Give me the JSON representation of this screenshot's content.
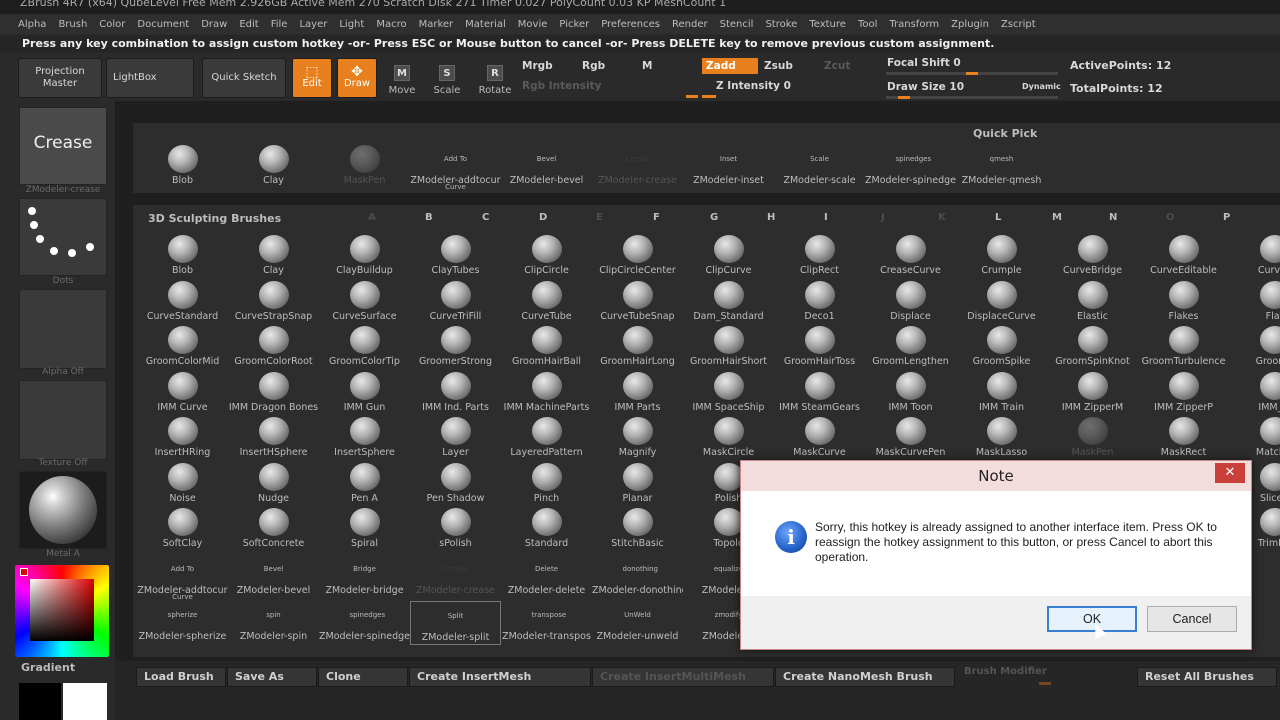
{
  "titlebar": "ZBrush 4R7 (x64)  QubeLevel   Free Mem 2.926GB  Active Mem 270  Scratch Disk 271  Timer 0.027  PolyCount 0.03 KP  MeshCount 1",
  "menu": [
    "Alpha",
    "Brush",
    "Color",
    "Document",
    "Draw",
    "Edit",
    "File",
    "Layer",
    "Light",
    "Macro",
    "Marker",
    "Material",
    "Movie",
    "Picker",
    "Preferences",
    "Render",
    "Stencil",
    "Stroke",
    "Texture",
    "Tool",
    "Transform",
    "Zplugin",
    "Zscript"
  ],
  "notice": "Press any key combination to assign custom hotkey -or- Press ESC or Mouse button to cancel -or- Press DELETE key to remove previous custom assignment.",
  "toolbar": {
    "projection_master": "Projection Master",
    "lightbox": "LightBox",
    "quick_sketch": "Quick Sketch",
    "edit": "Edit",
    "draw": "Draw",
    "move": "Move",
    "scale": "Scale",
    "rotate": "Rotate",
    "mrgb": "Mrgb",
    "rgb": "Rgb",
    "m": "M",
    "zadd": "Zadd",
    "zsub": "Zsub",
    "zcut": "Zcut",
    "rgb_intensity": "Rgb Intensity",
    "z_intensity": "Z Intensity 0",
    "focal_shift": "Focal Shift 0",
    "draw_size": "Draw Size 10",
    "dynamic": "Dynamic",
    "active_points": "ActivePoints: 12",
    "total_points": "TotalPoints: 12"
  },
  "left": {
    "crease": "Crease",
    "crease_label": "ZModeler-crease",
    "dots_label": "Dots",
    "alpha_label": "Alpha Off",
    "texture_label": "Texture Off",
    "material_label": "Metal A",
    "gradient": "Gradient"
  },
  "quick_pick": {
    "title": "Quick Pick",
    "items": [
      {
        "label": "Blob",
        "thumb": ""
      },
      {
        "label": "Clay",
        "thumb": ""
      },
      {
        "label": "MaskPen",
        "thumb": "",
        "dim": true
      },
      {
        "label": "ZModeler-addtocur",
        "thumb": "Add To Curve"
      },
      {
        "label": "ZModeler-bevel",
        "thumb": "Bevel"
      },
      {
        "label": "ZModeler-crease",
        "thumb": "Crease",
        "dim": true
      },
      {
        "label": "ZModeler-inset",
        "thumb": "Inset"
      },
      {
        "label": "ZModeler-scale",
        "thumb": "Scale"
      },
      {
        "label": "ZModeler-spinedges",
        "thumb": "spinedges"
      },
      {
        "label": "ZModeler-qmesh",
        "thumb": "qmesh"
      }
    ]
  },
  "sculpt": {
    "title": "3D Sculpting Brushes",
    "letters": [
      "A",
      "B",
      "C",
      "D",
      "E",
      "F",
      "G",
      "H",
      "I",
      "J",
      "K",
      "L",
      "M",
      "N",
      "O",
      "P"
    ],
    "rows": [
      [
        "Blob",
        "Clay",
        "ClayBuildup",
        "ClayTubes",
        "ClipCircle",
        "ClipCircleCenter",
        "ClipCurve",
        "ClipRect",
        "CreaseCurve",
        "Crumple",
        "CurveBridge",
        "CurveEditable",
        "CurveL"
      ],
      [
        "CurveStandard",
        "CurveStrapSnap",
        "CurveSurface",
        "CurveTriFill",
        "CurveTube",
        "CurveTubeSnap",
        "Dam_Standard",
        "Deco1",
        "Displace",
        "DisplaceCurve",
        "Elastic",
        "Flakes",
        "Flat"
      ],
      [
        "GroomColorMid",
        "GroomColorRoot",
        "GroomColorTip",
        "GroomerStrong",
        "GroomHairBall",
        "GroomHairLong",
        "GroomHairShort",
        "GroomHairToss",
        "GroomLengthen",
        "GroomSpike",
        "GroomSpinKnot",
        "GroomTurbulence",
        "GroomT"
      ],
      [
        "IMM Curve",
        "IMM Dragon Bones",
        "IMM Gun",
        "IMM Ind. Parts",
        "IMM MachineParts",
        "IMM Parts",
        "IMM SpaceShip",
        "IMM SteamGears",
        "IMM Toon",
        "IMM Train",
        "IMM ZipperM",
        "IMM ZipperP",
        "IMM_M"
      ],
      [
        "InsertHRing",
        "InsertHSphere",
        "InsertSphere",
        "Layer",
        "LayeredPattern",
        "Magnify",
        "MaskCircle",
        "MaskCurve",
        "MaskCurvePen",
        "MaskLasso",
        "MaskPen",
        "MaskRect",
        "MatchM"
      ],
      [
        "Noise",
        "Nudge",
        "Pen A",
        "Pen Shadow",
        "Pinch",
        "Planar",
        "Polish",
        "",
        "",
        "",
        "",
        "",
        "SliceC"
      ],
      [
        "SoftClay",
        "SoftConcrete",
        "Spiral",
        "sPolish",
        "Standard",
        "StitchBasic",
        "Topolo",
        "",
        "",
        "",
        "",
        "",
        "TrimDy"
      ]
    ],
    "zrows": [
      [
        {
          "label": "ZModeler-addtocur",
          "thumb": "Add To Curve"
        },
        {
          "label": "ZModeler-bevel",
          "thumb": "Bevel"
        },
        {
          "label": "ZModeler-bridge",
          "thumb": "Bridge"
        },
        {
          "label": "ZModeler-crease",
          "thumb": "Crease",
          "dim": true
        },
        {
          "label": "ZModeler-delete",
          "thumb": "Delete"
        },
        {
          "label": "ZModeler-donothing",
          "thumb": "donothing"
        },
        {
          "label": "ZModeler-e",
          "thumb": "equalize"
        }
      ],
      [
        {
          "label": "ZModeler-spherize",
          "thumb": "spherize"
        },
        {
          "label": "ZModeler-spin",
          "thumb": "spin"
        },
        {
          "label": "ZModeler-spinedges",
          "thumb": "spinedges"
        },
        {
          "label": "ZModeler-split",
          "thumb": "Split",
          "sel": true
        },
        {
          "label": "ZModeler-transpos",
          "thumb": "transpose"
        },
        {
          "label": "ZModeler-unweld",
          "thumb": "UnWeld"
        },
        {
          "label": "ZModeler-z",
          "thumb": "zmodify"
        }
      ]
    ]
  },
  "bottom": {
    "load_brush": "Load Brush",
    "save_as": "Save As",
    "clone": "Clone",
    "create_insertmesh": "Create InsertMesh",
    "create_insertmultimesh": "Create InsertMultiMesh",
    "create_nanomesh": "Create NanoMesh Brush",
    "brush_modifier": "Brush Modifier",
    "reset_all": "Reset All Brushes"
  },
  "dialog": {
    "title": "Note",
    "close": "✕",
    "message": "Sorry, this hotkey is already assigned to another interface item. Press OK to reassign the hotkey assignment to this button, or press Cancel to abort this operation.",
    "ok": "OK",
    "cancel": "Cancel",
    "icon": "info-icon"
  }
}
